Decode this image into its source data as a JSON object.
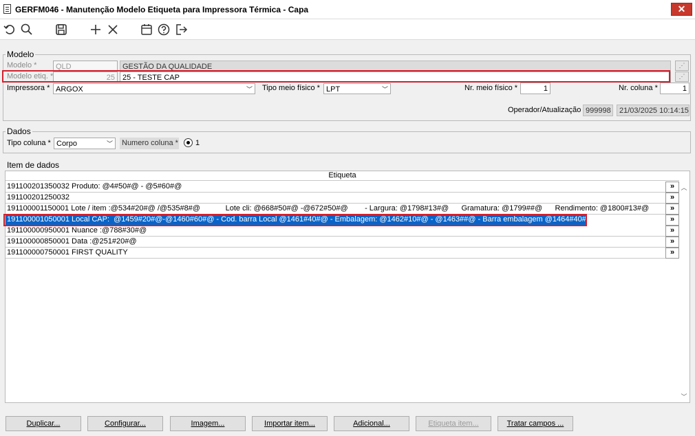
{
  "window": {
    "title": "GERFM046 - Manutenção Modelo Etiqueta para Impressora Térmica - Capa",
    "close_glyph": "✕"
  },
  "toolbar": {
    "icons": [
      "undo-icon",
      "search-icon",
      "save-icon",
      "add-icon",
      "delete-icon",
      "calendar-icon",
      "help-icon",
      "exit-icon"
    ]
  },
  "modelo": {
    "legend": "Modelo",
    "modelo_label": "Modelo *",
    "modelo_code": "QLD",
    "modelo_desc": "GESTÃO DA QUALIDADE",
    "etiq_label": "Modelo etiq. *",
    "etiq_code": "25",
    "etiq_desc": "25 - TESTE CAP",
    "impressora_label": "Impressora *",
    "impressora_value": "ARGOX",
    "tipo_meio_label": "Tipo meio físico *",
    "tipo_meio_value": "LPT",
    "nr_meio_label": "Nr. meio físico *",
    "nr_meio_value": "1",
    "nr_coluna_label": "Nr. coluna *",
    "nr_coluna_value": "1",
    "operador_label": "Operador/Atualização",
    "operador_value": "999998",
    "atualizacao_value": "21/03/2025 10:14:15"
  },
  "dados": {
    "legend": "Dados",
    "tipo_coluna_label": "Tipo coluna *",
    "tipo_coluna_value": "Corpo",
    "numero_coluna_label": "Numero coluna *",
    "numero_coluna_value": "1"
  },
  "items": {
    "legend": "Item de dados",
    "column_header": "Etiqueta",
    "expand_glyph": "»",
    "rows": [
      "191100201350032 Produto: @4#50#@ - @5#60#@",
      "191100201250032",
      "191100001150001 Lote / item :@534#20#@ /@535#8#@            Lote cli: @668#50#@ -@672#50#@        - Largura: @1798#13#@      Gramatura: @1799##@      Rendimento: @1800#13#@",
      "191100001050001 Local CAP:  @1459#20#@-@1460#60#@ - Cod. barra Local @1461#40#@ - Embalagem: @1462#10#@ - @1463##@ - Barra embalagem @1464#40#@",
      "191100000950001 Nuance :@788#30#@",
      "191100000850001 Data :@251#20#@",
      "191100000750001 FIRST QUALITY"
    ],
    "selected_index": 3
  },
  "buttons": {
    "duplicar": "Duplicar...",
    "configurar": "Configurar...",
    "imagem": "Imagem...",
    "importar": "Importar item...",
    "adicional": "Adicional...",
    "etiqueta_item": "Etiqueta item...",
    "tratar_campos": "Tratar campos ..."
  }
}
